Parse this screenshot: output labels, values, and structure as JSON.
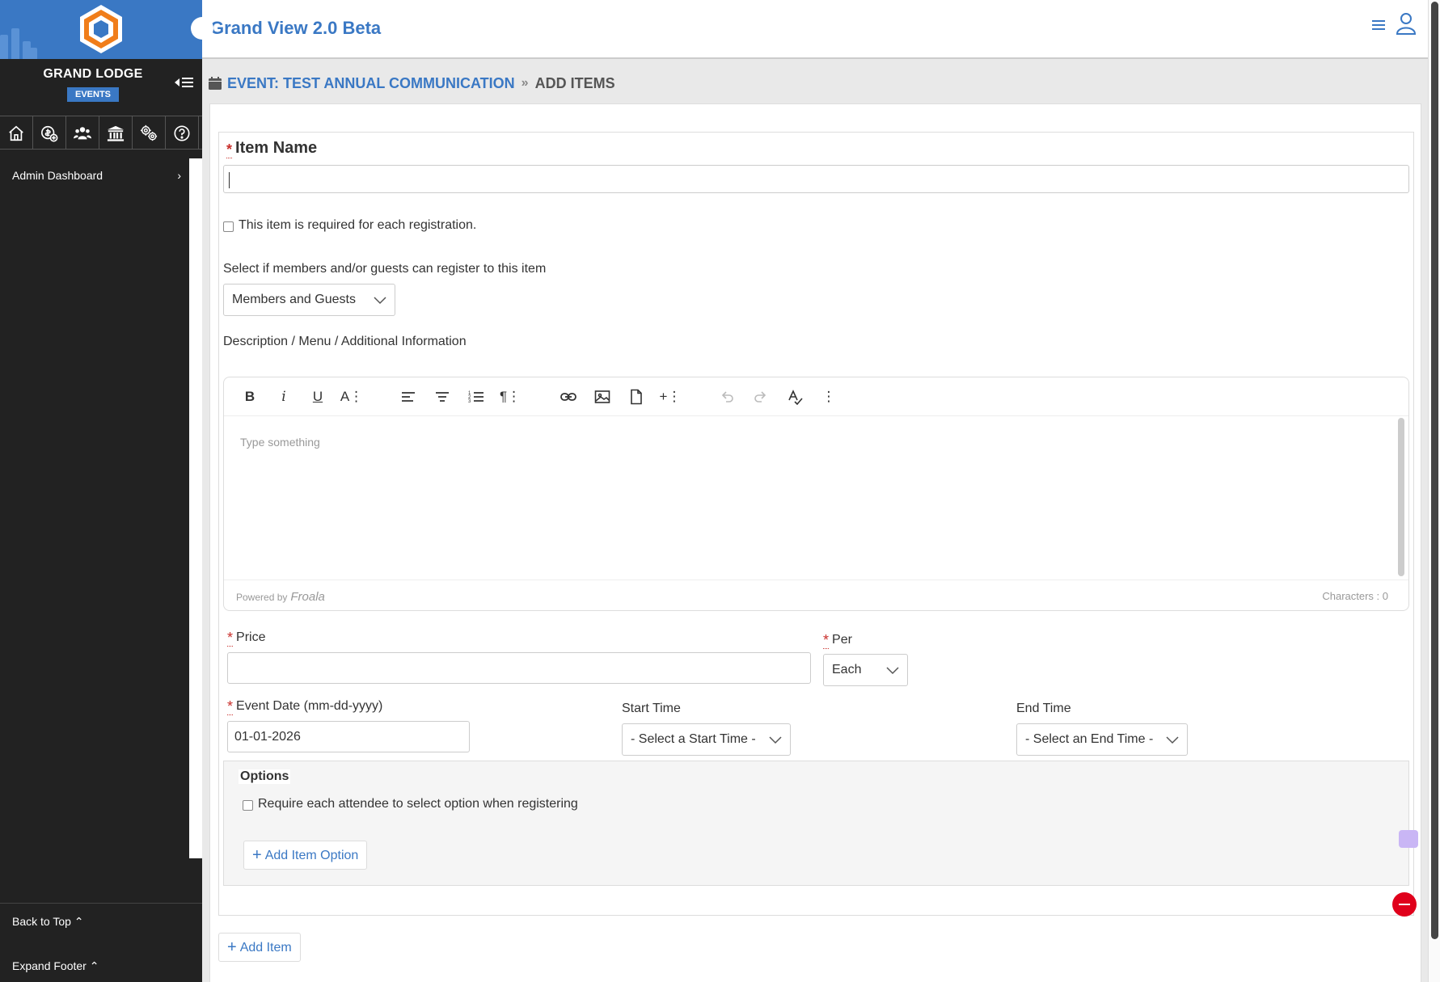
{
  "app": {
    "title": "Grand View 2.0 Beta"
  },
  "sidebar": {
    "title": "GRAND LODGE",
    "badge": "EVENTS",
    "icons": [
      "home-icon",
      "money-add-icon",
      "members-icon",
      "lodge-building-icon",
      "settings-gears-icon",
      "help-icon"
    ],
    "menu": [
      {
        "label": "Admin Dashboard"
      }
    ],
    "footer": {
      "back_to_top": "Back to Top",
      "expand_footer": "Expand Footer"
    }
  },
  "breadcrumb": {
    "event": "EVENT: TEST ANNUAL COMMUNICATION",
    "current": "ADD ITEMS"
  },
  "form": {
    "item_name_label": "Item Name",
    "item_name_value": "",
    "required_checkbox_label": "This item is required for each registration.",
    "register_label": "Select if members and/or guests can register to this item",
    "register_value": "Members and Guests",
    "description_label": "Description / Menu / Additional Information",
    "editor": {
      "placeholder": "Type something",
      "powered_by": "Powered by",
      "brand": "Froala",
      "chars": "Characters : 0"
    },
    "price_label": "Price",
    "price_value": "",
    "per_label": "Per",
    "per_value": "Each",
    "event_date_label": "Event Date (mm-dd-yyyy)",
    "event_date_value": "01-01-2026",
    "start_time_label": "Start Time",
    "start_time_value": "- Select a Start Time -",
    "end_time_label": "End Time",
    "end_time_value": "- Select an End Time -",
    "options_legend": "Options",
    "options_checkbox_label": "Require each attendee to select option when registering",
    "add_option_label": "Add Item Option",
    "add_item_label": "Add Item"
  },
  "colors": {
    "brand_blue": "#3a78c4",
    "sidebar_bg": "#222222",
    "danger": "#e0001b",
    "logo_orange": "#f07d1a"
  }
}
